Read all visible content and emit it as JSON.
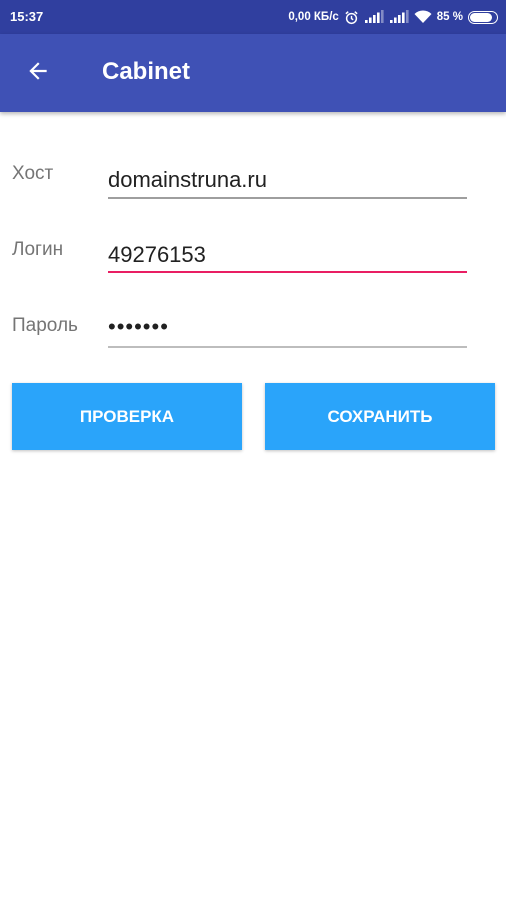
{
  "status_bar": {
    "time": "15:37",
    "network_speed": "0,00 КБ/с",
    "battery_percent": "85 %",
    "battery_level": 0.85,
    "icons": [
      "alarm-icon",
      "signal-icon",
      "signal-icon",
      "wifi-icon",
      "battery-icon"
    ]
  },
  "app_bar": {
    "back_icon": "arrow-left-icon",
    "title": "Cabinet",
    "color": "#3F51B5"
  },
  "form": {
    "host": {
      "label": "Хост",
      "value": "domainstruna.ru"
    },
    "login": {
      "label": "Логин",
      "value": "49276153",
      "focused": true
    },
    "password": {
      "label": "Пароль",
      "value": "•••••••"
    }
  },
  "buttons": {
    "check": "ПРОВЕРКА",
    "save": "СОХРАНИТЬ",
    "color": "#2AA4FA"
  },
  "colors": {
    "focus_accent": "#E91E63",
    "underline": "#9E9E9E"
  }
}
